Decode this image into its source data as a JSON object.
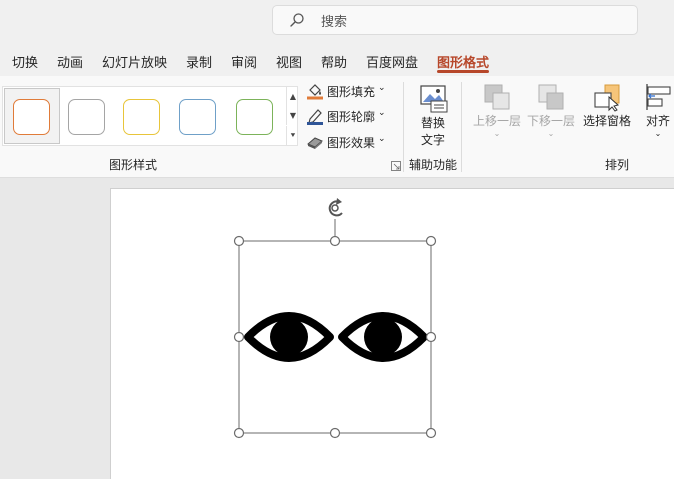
{
  "search": {
    "placeholder": "搜索"
  },
  "tabs": [
    {
      "label": "切换"
    },
    {
      "label": "动画"
    },
    {
      "label": "幻灯片放映"
    },
    {
      "label": "录制"
    },
    {
      "label": "审阅"
    },
    {
      "label": "视图"
    },
    {
      "label": "帮助"
    },
    {
      "label": "百度网盘"
    },
    {
      "label": "图形格式",
      "active": true
    }
  ],
  "ribbon": {
    "shape_styles": {
      "swatch_colors": [
        "#e07b39",
        "#a5a5a5",
        "#e8c53a",
        "#6fa0c8",
        "#7cb35a"
      ],
      "fill_label": "图形填充",
      "outline_label": "图形轮廓",
      "effects_label": "图形效果",
      "group_label": "图形样式"
    },
    "accessibility": {
      "alt_text_line1": "替换",
      "alt_text_line2": "文字",
      "group_label": "辅助功能"
    },
    "arrange": {
      "bring_forward_label": "上移一层",
      "send_backward_label": "下移一层",
      "selection_pane_label": "选择窗格",
      "align_label": "对齐",
      "group_label": "排列"
    }
  },
  "colors": {
    "accent": "#b7472a",
    "fill_icon_bar": "#e07b39",
    "outline_icon_bar": "#2f5597"
  }
}
